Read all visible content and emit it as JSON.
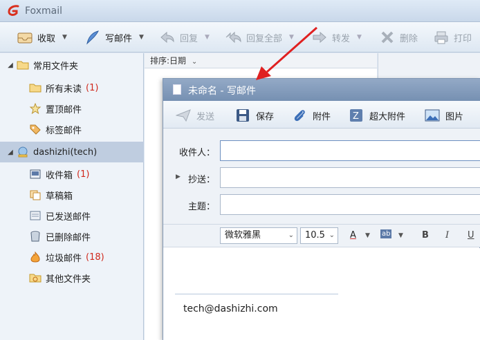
{
  "app": {
    "title": "Foxmail"
  },
  "toolbar": {
    "receive": "收取",
    "compose": "写邮件",
    "reply": "回复",
    "reply_all": "回复全部",
    "forward": "转发",
    "delete": "删除",
    "print": "打印"
  },
  "sidebar": {
    "common_group": "常用文件夹",
    "common_items": [
      {
        "label": "所有未读",
        "count": "(1)"
      },
      {
        "label": "置顶邮件"
      },
      {
        "label": "标签邮件"
      }
    ],
    "account": "dashizhi(tech)",
    "account_items": [
      {
        "label": "收件箱",
        "count": "(1)"
      },
      {
        "label": "草稿箱"
      },
      {
        "label": "已发送邮件"
      },
      {
        "label": "已删除邮件"
      },
      {
        "label": "垃圾邮件",
        "count": "(18)"
      },
      {
        "label": "其他文件夹"
      }
    ]
  },
  "list": {
    "sort_label": "排序:日期"
  },
  "compose": {
    "title": "未命名 - 写邮件",
    "toolbar": {
      "send": "发送",
      "save": "保存",
      "attach": "附件",
      "large_attach": "超大附件",
      "image": "图片"
    },
    "fields": {
      "to_label": "收件人：",
      "cc_label": "抄送：",
      "subject_label": "主题：",
      "to_value": "",
      "cc_value": "",
      "subject_value": ""
    },
    "format": {
      "font": "微软雅黑",
      "size": "10.5",
      "color_btn": "A",
      "highlight_btn": "ab",
      "bold": "B",
      "italic": "I",
      "underline": "U"
    },
    "signature": "tech@dashizhi.com"
  },
  "colors": {
    "accent": "#7690b2",
    "badge": "#d0281c",
    "annotation": "#e02020"
  }
}
